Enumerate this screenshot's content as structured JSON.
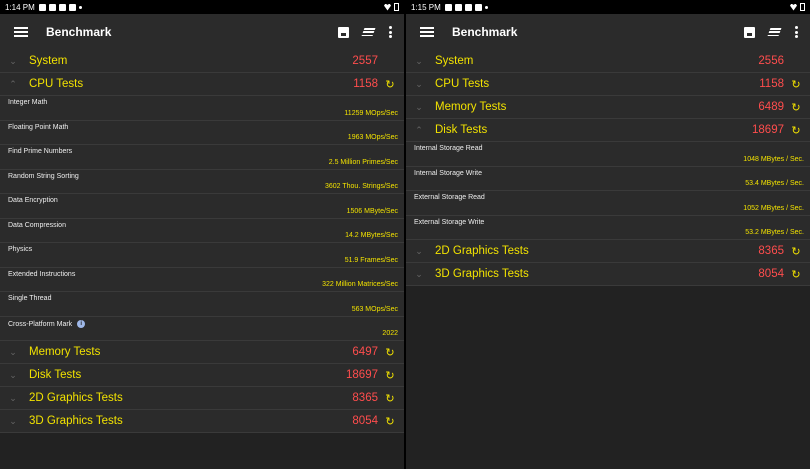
{
  "app_title": "Benchmark",
  "left": {
    "status_time": "1:14 PM",
    "rows": [
      {
        "kind": "cat",
        "name": "System",
        "score": "2557",
        "chev": "⌄",
        "rerun": false
      },
      {
        "kind": "cat",
        "name": "CPU Tests",
        "score": "1158",
        "chev": "⌃",
        "rerun": true
      },
      {
        "kind": "sub",
        "name": "Integer Math",
        "value": "11259 MOps/Sec"
      },
      {
        "kind": "sub",
        "name": "Floating Point Math",
        "value": "1963 MOps/Sec"
      },
      {
        "kind": "sub",
        "name": "Find Prime Numbers",
        "value": "2.5 Million Primes/Sec"
      },
      {
        "kind": "sub",
        "name": "Random String Sorting",
        "value": "3602 Thou. Strings/Sec"
      },
      {
        "kind": "sub",
        "name": "Data Encryption",
        "value": "1506 MByte/Sec"
      },
      {
        "kind": "sub",
        "name": "Data Compression",
        "value": "14.2 MBytes/Sec"
      },
      {
        "kind": "sub",
        "name": "Physics",
        "value": "51.9 Frames/Sec"
      },
      {
        "kind": "sub",
        "name": "Extended Instructions",
        "value": "322 Million Matrices/Sec"
      },
      {
        "kind": "sub",
        "name": "Single Thread",
        "value": "563 MOps/Sec"
      },
      {
        "kind": "sub",
        "name": "Cross-Platform Mark",
        "value": "2022",
        "info": true
      },
      {
        "kind": "cat",
        "name": "Memory Tests",
        "score": "6497",
        "chev": "⌄",
        "rerun": true
      },
      {
        "kind": "cat",
        "name": "Disk Tests",
        "score": "18697",
        "chev": "⌄",
        "rerun": true
      },
      {
        "kind": "cat",
        "name": "2D Graphics Tests",
        "score": "8365",
        "chev": "⌄",
        "rerun": true
      },
      {
        "kind": "cat",
        "name": "3D Graphics Tests",
        "score": "8054",
        "chev": "⌄",
        "rerun": true
      }
    ]
  },
  "right": {
    "status_time": "1:15 PM",
    "rows": [
      {
        "kind": "cat",
        "name": "System",
        "score": "2556",
        "chev": "⌄",
        "rerun": false
      },
      {
        "kind": "cat",
        "name": "CPU Tests",
        "score": "1158",
        "chev": "⌄",
        "rerun": true
      },
      {
        "kind": "cat",
        "name": "Memory Tests",
        "score": "6489",
        "chev": "⌄",
        "rerun": true
      },
      {
        "kind": "cat",
        "name": "Disk Tests",
        "score": "18697",
        "chev": "⌃",
        "rerun": true
      },
      {
        "kind": "sub",
        "name": "Internal Storage Read",
        "value": "1048 MBytes / Sec."
      },
      {
        "kind": "sub",
        "name": "Internal Storage Write",
        "value": "53.4 MBytes / Sec."
      },
      {
        "kind": "sub",
        "name": "External Storage Read",
        "value": "1052 MBytes / Sec."
      },
      {
        "kind": "sub",
        "name": "External Storage Write",
        "value": "53.2 MBytes / Sec."
      },
      {
        "kind": "cat",
        "name": "2D Graphics Tests",
        "score": "8365",
        "chev": "⌄",
        "rerun": true
      },
      {
        "kind": "cat",
        "name": "3D Graphics Tests",
        "score": "8054",
        "chev": "⌄",
        "rerun": true
      }
    ]
  },
  "icons": {
    "info": "i",
    "rerun": "↻"
  },
  "colors": {
    "category": "#f2e200",
    "score": "#ff4d4d",
    "value": "#f2e200",
    "background": "#2b2b2b"
  }
}
